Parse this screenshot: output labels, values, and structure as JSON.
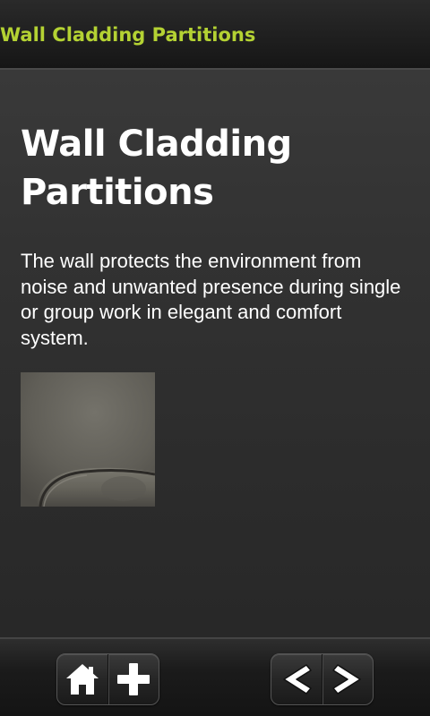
{
  "titlebar": {
    "title": "Wall Cladding Partitions",
    "title_color": "#b4d233"
  },
  "content": {
    "heading": "Wall Cladding Partitions",
    "description": "The wall protects the environment from noise and unwanted presence during single or group work in elegant and comfort system."
  },
  "toolbar": {
    "buttons": [
      {
        "icon": "home-icon"
      },
      {
        "icon": "plus-icon"
      },
      {
        "icon": "arrow-left-icon"
      },
      {
        "icon": "arrow-right-icon"
      }
    ]
  }
}
